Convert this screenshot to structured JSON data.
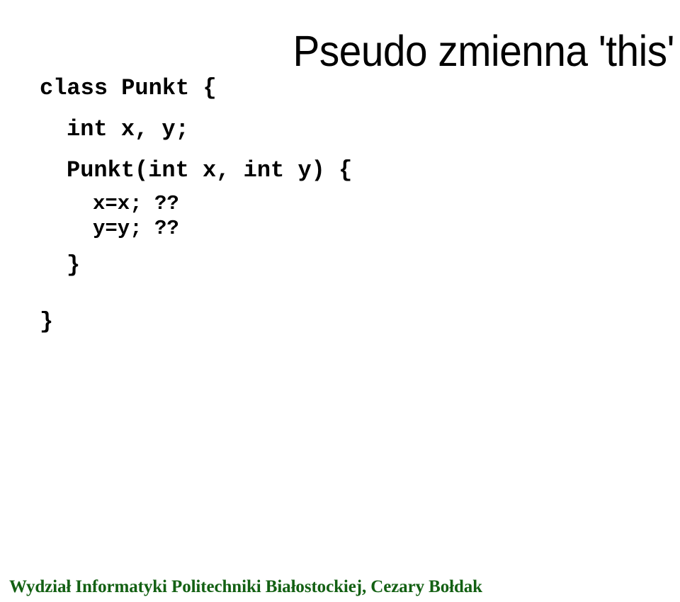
{
  "slide": {
    "title": "Pseudo zmienna 'this'",
    "code_lines": [
      {
        "text": "class Punkt {",
        "indent": 0,
        "size": "big"
      },
      {
        "text": "int x, y;",
        "indent": 1,
        "size": "big"
      },
      {
        "text": "Punkt(int x, int y) {",
        "indent": 1,
        "size": "big"
      },
      {
        "text": "x=x; ??",
        "indent": 2,
        "size": "small"
      },
      {
        "text": "y=y; ??",
        "indent": 2,
        "size": "small"
      },
      {
        "text": "}",
        "indent": 1,
        "size": "big"
      },
      {
        "text": "}",
        "indent": 0,
        "size": "big"
      }
    ],
    "footer": "Wydział Informatyki Politechniki Białostockiej, Cezary Bołdak",
    "colors": {
      "background": "#ffffff",
      "title_text": "#000000",
      "code_text": "#000000",
      "footer_text": "#136013"
    }
  }
}
